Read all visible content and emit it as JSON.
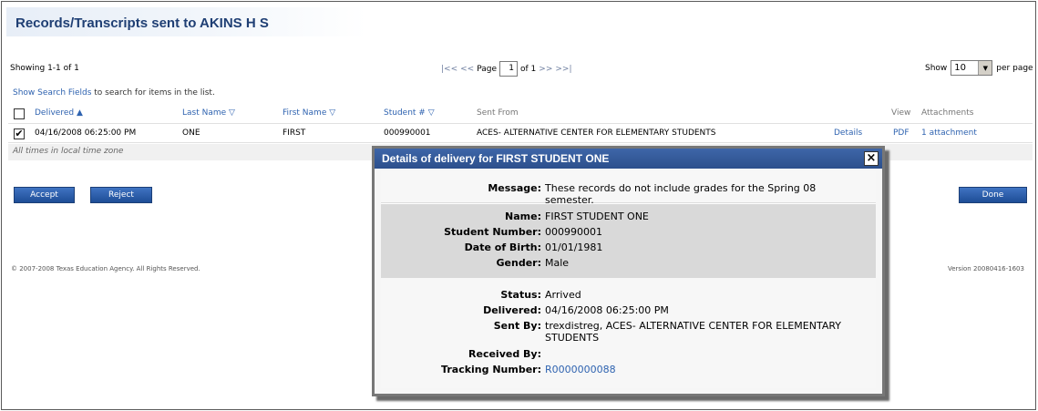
{
  "page": {
    "title": "Records/Transcripts sent to AKINS H S"
  },
  "pagination": {
    "showing": "Showing 1-1 of 1",
    "first": "|<<",
    "prev": "<<",
    "page_label": "Page",
    "page_value": "1",
    "of_label": "of 1",
    "next": ">>",
    "last": ">>|",
    "show_label": "Show",
    "per_page_value": "10",
    "per_page_label": "per page"
  },
  "search": {
    "link": "Show Search Fields",
    "suffix": "to search for items in the list."
  },
  "table": {
    "headers": {
      "delivered": "Delivered ▲",
      "last_name": "Last Name ▽",
      "first_name": "First Name ▽",
      "student_no": "Student # ▽",
      "sent_from": "Sent From",
      "view": "View",
      "attachments": "Attachments"
    },
    "rows": [
      {
        "checked": "✔",
        "delivered": "04/16/2008 06:25:00 PM",
        "last_name": "ONE",
        "first_name": "FIRST",
        "student_no": "000990001",
        "sent_from": "ACES- ALTERNATIVE CENTER FOR ELEMENTARY STUDENTS",
        "details": "Details",
        "view": "PDF",
        "attachments": "1 attachment"
      }
    ],
    "note": "All times in local time zone"
  },
  "buttons": {
    "accept": "Accept",
    "reject": "Reject",
    "done": "Done"
  },
  "footer": {
    "copyright": "© 2007-2008 Texas Education Agency. All Rights Reserved.",
    "version": "Version 20080416-1603"
  },
  "modal": {
    "title": "Details of delivery for FIRST STUDENT ONE",
    "close": "×",
    "message_label": "Message:",
    "message": "These records do not include grades for the Spring 08 semester.",
    "name_label": "Name:",
    "name": "FIRST STUDENT ONE",
    "student_number_label": "Student Number:",
    "student_number": "000990001",
    "dob_label": "Date of Birth:",
    "dob": "01/01/1981",
    "gender_label": "Gender:",
    "gender": "Male",
    "status_label": "Status:",
    "status": "Arrived",
    "delivered_label": "Delivered:",
    "delivered": "04/16/2008 06:25:00 PM",
    "sent_by_label": "Sent By:",
    "sent_by": "trexdistreg, ACES- ALTERNATIVE CENTER FOR ELEMENTARY STUDENTS",
    "received_by_label": "Received By:",
    "received_by": "",
    "tracking_label": "Tracking Number:",
    "tracking": "R0000000088"
  }
}
